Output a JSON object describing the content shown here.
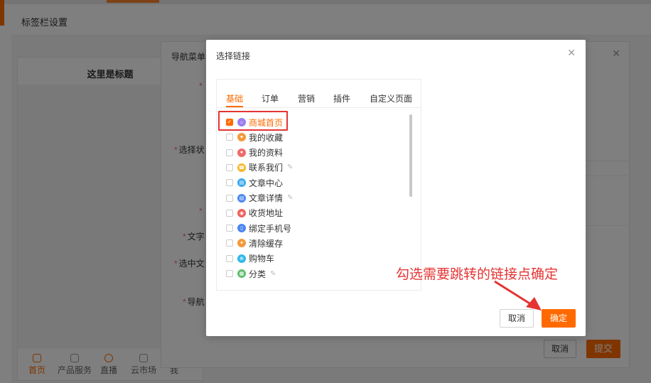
{
  "page": {
    "title": "标签栏设置"
  },
  "colors": {
    "accent": "#ff6a00",
    "annotation": "#e53333"
  },
  "phone": {
    "title": "这里是标题",
    "nav": [
      {
        "label": "首页",
        "icon": "home-icon",
        "active": true
      },
      {
        "label": "产品服务",
        "icon": "box-icon",
        "active": false
      },
      {
        "label": "直播",
        "icon": "live-icon",
        "active": false
      },
      {
        "label": "云市场",
        "icon": "cloud-icon",
        "active": false
      },
      {
        "label": "我",
        "icon": "user-icon",
        "active": false
      }
    ]
  },
  "form": {
    "title": "导航菜单",
    "labels": {
      "select_status": "选择状",
      "text": "文字",
      "selected_text": "选中文",
      "nav": "导航"
    },
    "cancel_label": "取消",
    "submit_label": "提交"
  },
  "modal": {
    "title": "选择链接",
    "tabs": [
      "基础",
      "订单",
      "营销",
      "插件",
      "自定义页面"
    ],
    "items": [
      {
        "label": "商城首页",
        "icon": "home-icon",
        "color": "#9b7cf0",
        "checked": true,
        "editable": false
      },
      {
        "label": "我的收藏",
        "icon": "heart-icon",
        "color": "#f39a3b",
        "checked": false,
        "editable": false
      },
      {
        "label": "我的资料",
        "icon": "profile-icon",
        "color": "#f06a6a",
        "checked": false,
        "editable": false
      },
      {
        "label": "联系我们",
        "icon": "contact-icon",
        "color": "#f3b72c",
        "checked": false,
        "editable": true
      },
      {
        "label": "文章中心",
        "icon": "article-icon",
        "color": "#3aa8f0",
        "checked": false,
        "editable": false
      },
      {
        "label": "文章详情",
        "icon": "article-detail-icon",
        "color": "#4a86f0",
        "checked": false,
        "editable": true
      },
      {
        "label": "收货地址",
        "icon": "location-icon",
        "color": "#f0605a",
        "checked": false,
        "editable": false
      },
      {
        "label": "绑定手机号",
        "icon": "phone-icon",
        "color": "#4a86f0",
        "checked": false,
        "editable": false
      },
      {
        "label": "清除缓存",
        "icon": "clear-cache-icon",
        "color": "#f39a3b",
        "checked": false,
        "editable": false
      },
      {
        "label": "购物车",
        "icon": "cart-icon",
        "color": "#33b8e8",
        "checked": false,
        "editable": false
      },
      {
        "label": "分类",
        "icon": "category-icon",
        "color": "#5cbf6a",
        "checked": false,
        "editable": true
      }
    ],
    "cancel_label": "取消",
    "ok_label": "确定"
  },
  "annotation": {
    "text": "勾选需要跳转的链接点确定"
  }
}
